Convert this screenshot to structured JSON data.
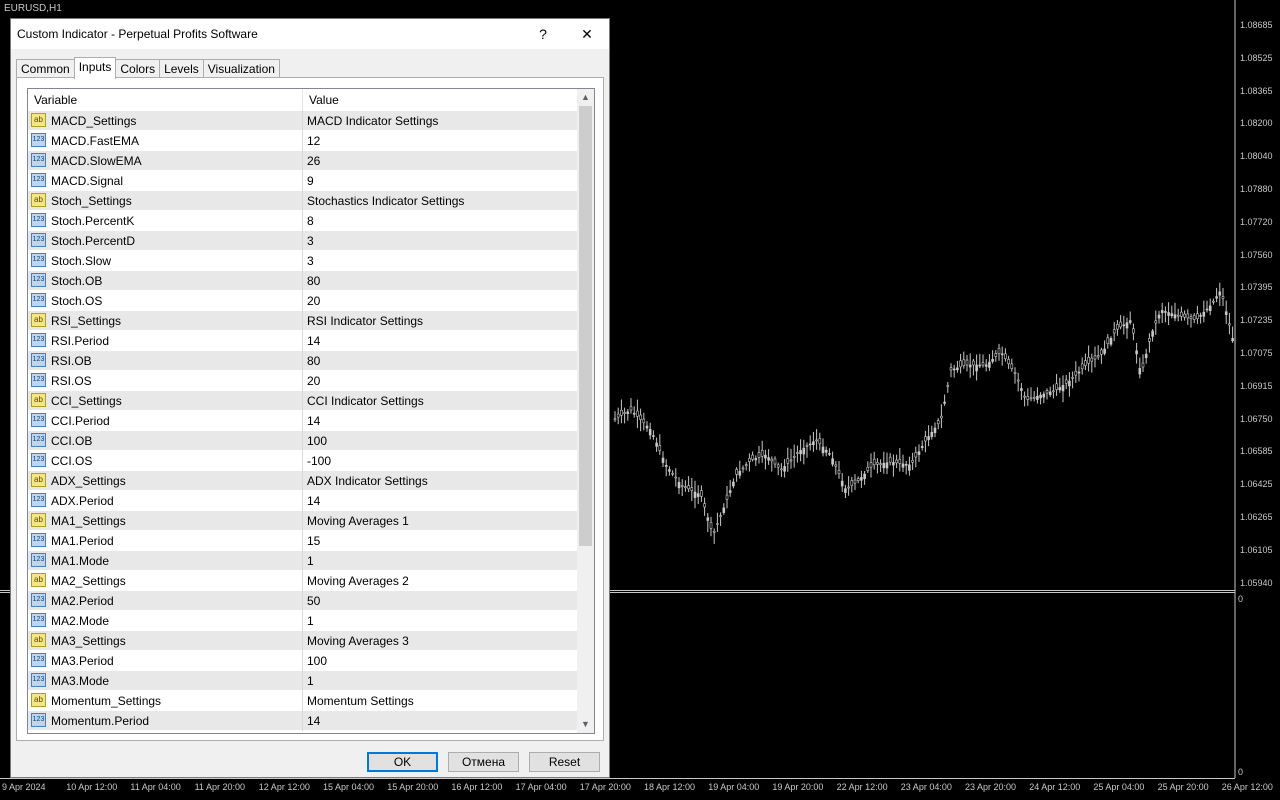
{
  "chart": {
    "symbol": "EURUSD,H1",
    "price_labels": [
      "1.08685",
      "1.08525",
      "1.08365",
      "1.08200",
      "1.08040",
      "1.07880",
      "1.07720",
      "1.07560",
      "1.07395",
      "1.07235",
      "1.07075",
      "1.06915",
      "1.06750",
      "1.06585",
      "1.06425",
      "1.06265",
      "1.06105",
      "1.05940"
    ],
    "time_labels": [
      "9 Apr 2024",
      "10 Apr 12:00",
      "11 Apr 04:00",
      "11 Apr 20:00",
      "12 Apr 12:00",
      "15 Apr 04:00",
      "15 Apr 20:00",
      "16 Apr 12:00",
      "17 Apr 04:00",
      "17 Apr 20:00",
      "18 Apr 12:00",
      "19 Apr 04:00",
      "19 Apr 20:00",
      "22 Apr 12:00",
      "23 Apr 04:00",
      "23 Apr 20:00",
      "24 Apr 12:00",
      "25 Apr 04:00",
      "25 Apr 20:00",
      "26 Apr 12:00"
    ],
    "sub_top": "0",
    "sub_bottom": "0",
    "colors": {
      "background": "#000000",
      "candle": "#c8c8c8",
      "text": "#c8c8c8"
    }
  },
  "dialog": {
    "title": "Custom Indicator - Perpetual Profits Software",
    "help": "?",
    "close": "✕",
    "tabs": [
      "Common",
      "Inputs",
      "Colors",
      "Levels",
      "Visualization"
    ],
    "active_tab": "Inputs",
    "columns": [
      "Variable",
      "Value"
    ],
    "rows": [
      {
        "name": "MACD_Settings",
        "value": "MACD Indicator Settings",
        "type": "str"
      },
      {
        "name": "MACD.FastEMA",
        "value": "12",
        "type": "num"
      },
      {
        "name": "MACD.SlowEMA",
        "value": "26",
        "type": "num"
      },
      {
        "name": "MACD.Signal",
        "value": "9",
        "type": "num"
      },
      {
        "name": "Stoch_Settings",
        "value": "Stochastics Indicator Settings",
        "type": "str"
      },
      {
        "name": "Stoch.PercentK",
        "value": "8",
        "type": "num"
      },
      {
        "name": "Stoch.PercentD",
        "value": "3",
        "type": "num"
      },
      {
        "name": "Stoch.Slow",
        "value": "3",
        "type": "num"
      },
      {
        "name": "Stoch.OB",
        "value": "80",
        "type": "num"
      },
      {
        "name": "Stoch.OS",
        "value": "20",
        "type": "num"
      },
      {
        "name": "RSI_Settings",
        "value": "RSI Indicator Settings",
        "type": "str"
      },
      {
        "name": "RSI.Period",
        "value": "14",
        "type": "num"
      },
      {
        "name": "RSI.OB",
        "value": "80",
        "type": "num"
      },
      {
        "name": "RSI.OS",
        "value": "20",
        "type": "num"
      },
      {
        "name": "CCI_Settings",
        "value": "CCI Indicator Settings",
        "type": "str"
      },
      {
        "name": "CCI.Period",
        "value": "14",
        "type": "num"
      },
      {
        "name": "CCI.OB",
        "value": "100",
        "type": "num"
      },
      {
        "name": "CCI.OS",
        "value": "-100",
        "type": "num"
      },
      {
        "name": "ADX_Settings",
        "value": "ADX Indicator Settings",
        "type": "str"
      },
      {
        "name": "ADX.Period",
        "value": "14",
        "type": "num"
      },
      {
        "name": "MA1_Settings",
        "value": "Moving Averages 1",
        "type": "str"
      },
      {
        "name": "MA1.Period",
        "value": "15",
        "type": "num"
      },
      {
        "name": "MA1.Mode",
        "value": "1",
        "type": "num"
      },
      {
        "name": "MA2_Settings",
        "value": "Moving Averages 2",
        "type": "str"
      },
      {
        "name": "MA2.Period",
        "value": "50",
        "type": "num"
      },
      {
        "name": "MA2.Mode",
        "value": "1",
        "type": "num"
      },
      {
        "name": "MA3_Settings",
        "value": "Moving Averages 3",
        "type": "str"
      },
      {
        "name": "MA3.Period",
        "value": "100",
        "type": "num"
      },
      {
        "name": "MA3.Mode",
        "value": "1",
        "type": "num"
      },
      {
        "name": "Momentum_Settings",
        "value": "Momentum Settings",
        "type": "str"
      },
      {
        "name": "Momentum.Period",
        "value": "14",
        "type": "num"
      }
    ],
    "icons": {
      "str": "ab",
      "num": "123"
    },
    "buttons": {
      "ok": "OK",
      "cancel": "Отмена",
      "reset": "Reset"
    },
    "colors": {
      "accent": "#0078d7",
      "str_icon": "#f3e58a",
      "num_icon": "#bcd6f2"
    }
  }
}
